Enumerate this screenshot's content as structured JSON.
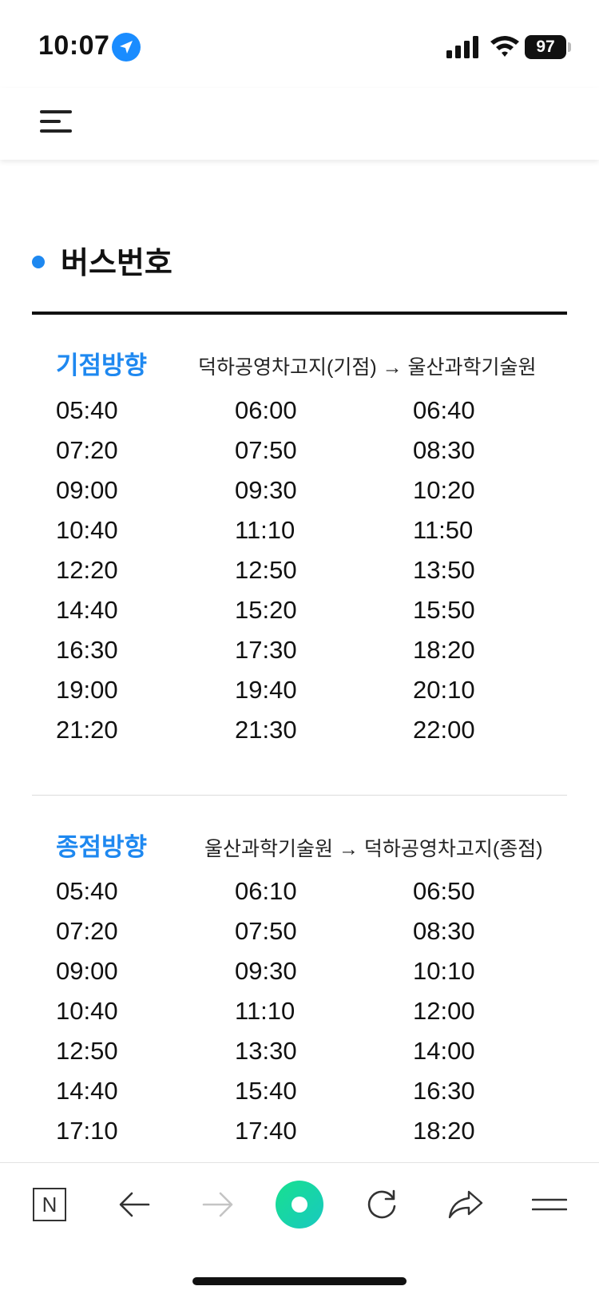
{
  "status_bar": {
    "time": "10:07",
    "battery": "97"
  },
  "section": {
    "title": "버스번호"
  },
  "directions": [
    {
      "label": "기점방향",
      "route": "덕하공영차고지(기점) → 울산과학기술원",
      "times": [
        [
          "05:40",
          "06:00",
          "06:40"
        ],
        [
          "07:20",
          "07:50",
          "08:30"
        ],
        [
          "09:00",
          "09:30",
          "10:20"
        ],
        [
          "10:40",
          "11:10",
          "11:50"
        ],
        [
          "12:20",
          "12:50",
          "13:50"
        ],
        [
          "14:40",
          "15:20",
          "15:50"
        ],
        [
          "16:30",
          "17:30",
          "18:20"
        ],
        [
          "19:00",
          "19:40",
          "20:10"
        ],
        [
          "21:20",
          "21:30",
          "22:00"
        ]
      ]
    },
    {
      "label": "종점방향",
      "route": "울산과학기술원 → 덕하공영차고지(종점)",
      "times": [
        [
          "05:40",
          "06:10",
          "06:50"
        ],
        [
          "07:20",
          "07:50",
          "08:30"
        ],
        [
          "09:00",
          "09:30",
          "10:10"
        ],
        [
          "10:40",
          "11:10",
          "12:00"
        ],
        [
          "12:50",
          "13:30",
          "14:00"
        ],
        [
          "14:40",
          "15:40",
          "16:30"
        ],
        [
          "17:10",
          "17:40",
          "18:20"
        ]
      ]
    }
  ],
  "toolbar": {
    "items": [
      "naver-n-icon",
      "back-arrow-icon",
      "forward-arrow-icon",
      "green-dot-icon",
      "refresh-icon",
      "share-icon",
      "menu-icon"
    ],
    "brand_color": "#1dd39a",
    "home_letter": "N"
  }
}
